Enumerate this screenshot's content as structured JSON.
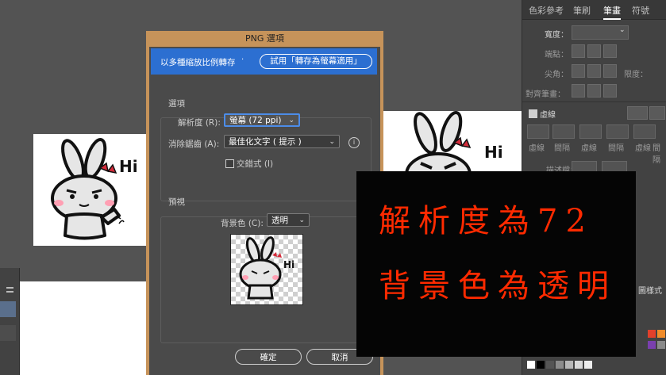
{
  "right_panel": {
    "tabs": [
      "色彩參考",
      "筆刷",
      "筆畫",
      "符號"
    ],
    "active_tab": "筆畫",
    "weight_label": "寬度：",
    "cap_label": "端點：",
    "corner_label": "尖角：",
    "limit_label": "限度：",
    "align_label": "對齊筆畫：",
    "dashed_label": "虛線",
    "dash_labels": [
      "虛線",
      "間隔",
      "虛線",
      "間隔",
      "虛線",
      "間隔"
    ],
    "profile_label": "描述檔：",
    "lower_tab": "圖樣式"
  },
  "dialog": {
    "title": "PNG 選項",
    "banner_text": "以多種縮放比例轉存",
    "banner_button": "試用「轉存為螢幕適用」",
    "options_group": "選項",
    "resolution_label": "解析度 (R):",
    "resolution_value": "螢幕 (72 ppi)",
    "antialias_label": "消除鋸齒 (A):",
    "antialias_value": "最佳化文字 ( 提示 )",
    "interlace_label": "交錯式 (I)",
    "interlace_checked": false,
    "preview_group": "預視",
    "background_label": "背景色 (C):",
    "background_value": "透明",
    "ok_button": "確定",
    "cancel_button": "取消"
  },
  "artwork": {
    "greeting": "Hi"
  },
  "annotation": {
    "line1": "解析度為72",
    "line2": "背景色為透明",
    "color": "#ff2a00"
  },
  "colors": {
    "canvas": "#535353",
    "accent": "#2c6fd1",
    "dialog_frame": "#c6935a"
  }
}
